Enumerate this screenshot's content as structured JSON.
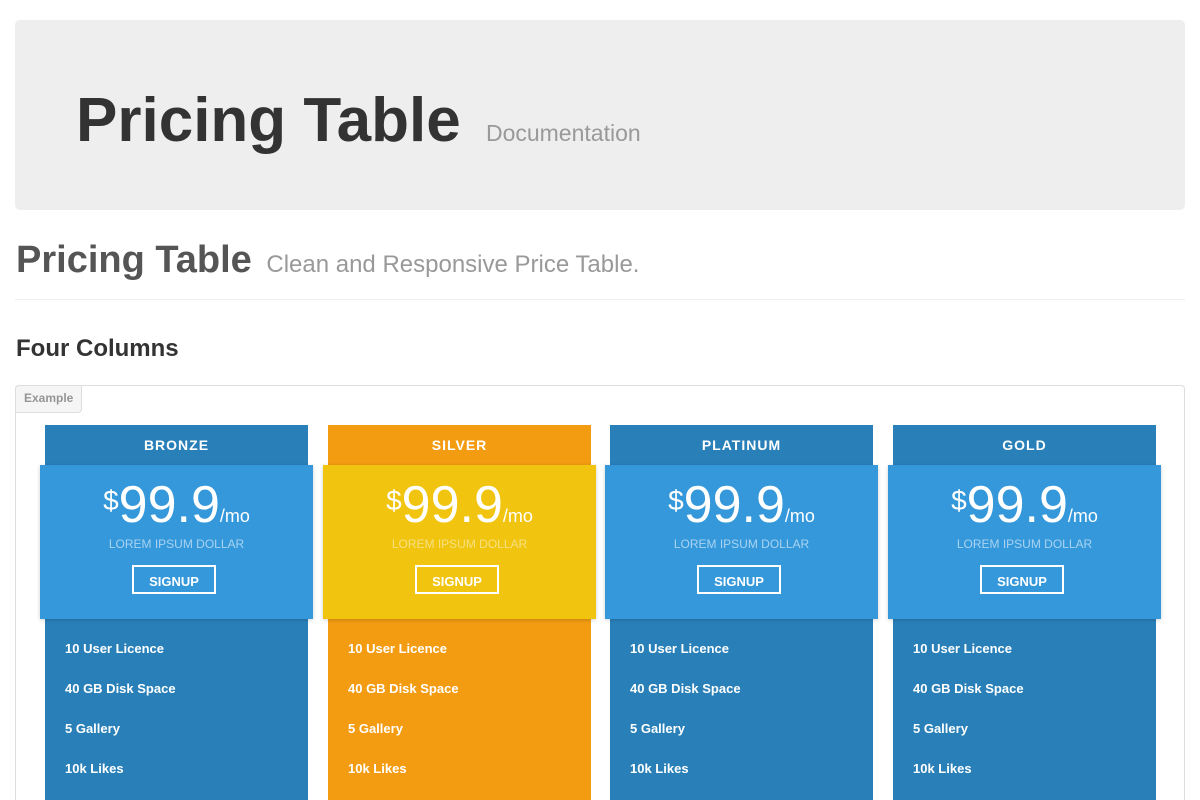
{
  "jumbotron": {
    "title": "Pricing Table",
    "subtitle": "Documentation"
  },
  "page_header": {
    "title": "Pricing Table",
    "subtitle": "Clean and Responsive Price Table."
  },
  "section": {
    "title": "Four Columns",
    "example_label": "Example"
  },
  "colors": {
    "blue_dark": "#2980b9",
    "blue_light": "#3498db",
    "orange": "#f39c12",
    "yellow": "#f1c40f"
  },
  "plans": [
    {
      "name": "BRONZE",
      "currency": "$",
      "amount": "99.9",
      "period": "/mo",
      "tagline": "LOREM IPSUM DOLLAR",
      "signup_label": "SIGNUP",
      "features": [
        "10 User Licence",
        "40 GB Disk Space",
        "5 Gallery",
        "10k Likes"
      ]
    },
    {
      "name": "SILVER",
      "currency": "$",
      "amount": "99.9",
      "period": "/mo",
      "tagline": "LOREM IPSUM DOLLAR",
      "signup_label": "SIGNUP",
      "features": [
        "10 User Licence",
        "40 GB Disk Space",
        "5 Gallery",
        "10k Likes"
      ]
    },
    {
      "name": "PLATINUM",
      "currency": "$",
      "amount": "99.9",
      "period": "/mo",
      "tagline": "LOREM IPSUM DOLLAR",
      "signup_label": "SIGNUP",
      "features": [
        "10 User Licence",
        "40 GB Disk Space",
        "5 Gallery",
        "10k Likes"
      ]
    },
    {
      "name": "GOLD",
      "currency": "$",
      "amount": "99.9",
      "period": "/mo",
      "tagline": "LOREM IPSUM DOLLAR",
      "signup_label": "SIGNUP",
      "features": [
        "10 User Licence",
        "40 GB Disk Space",
        "5 Gallery",
        "10k Likes"
      ]
    }
  ]
}
